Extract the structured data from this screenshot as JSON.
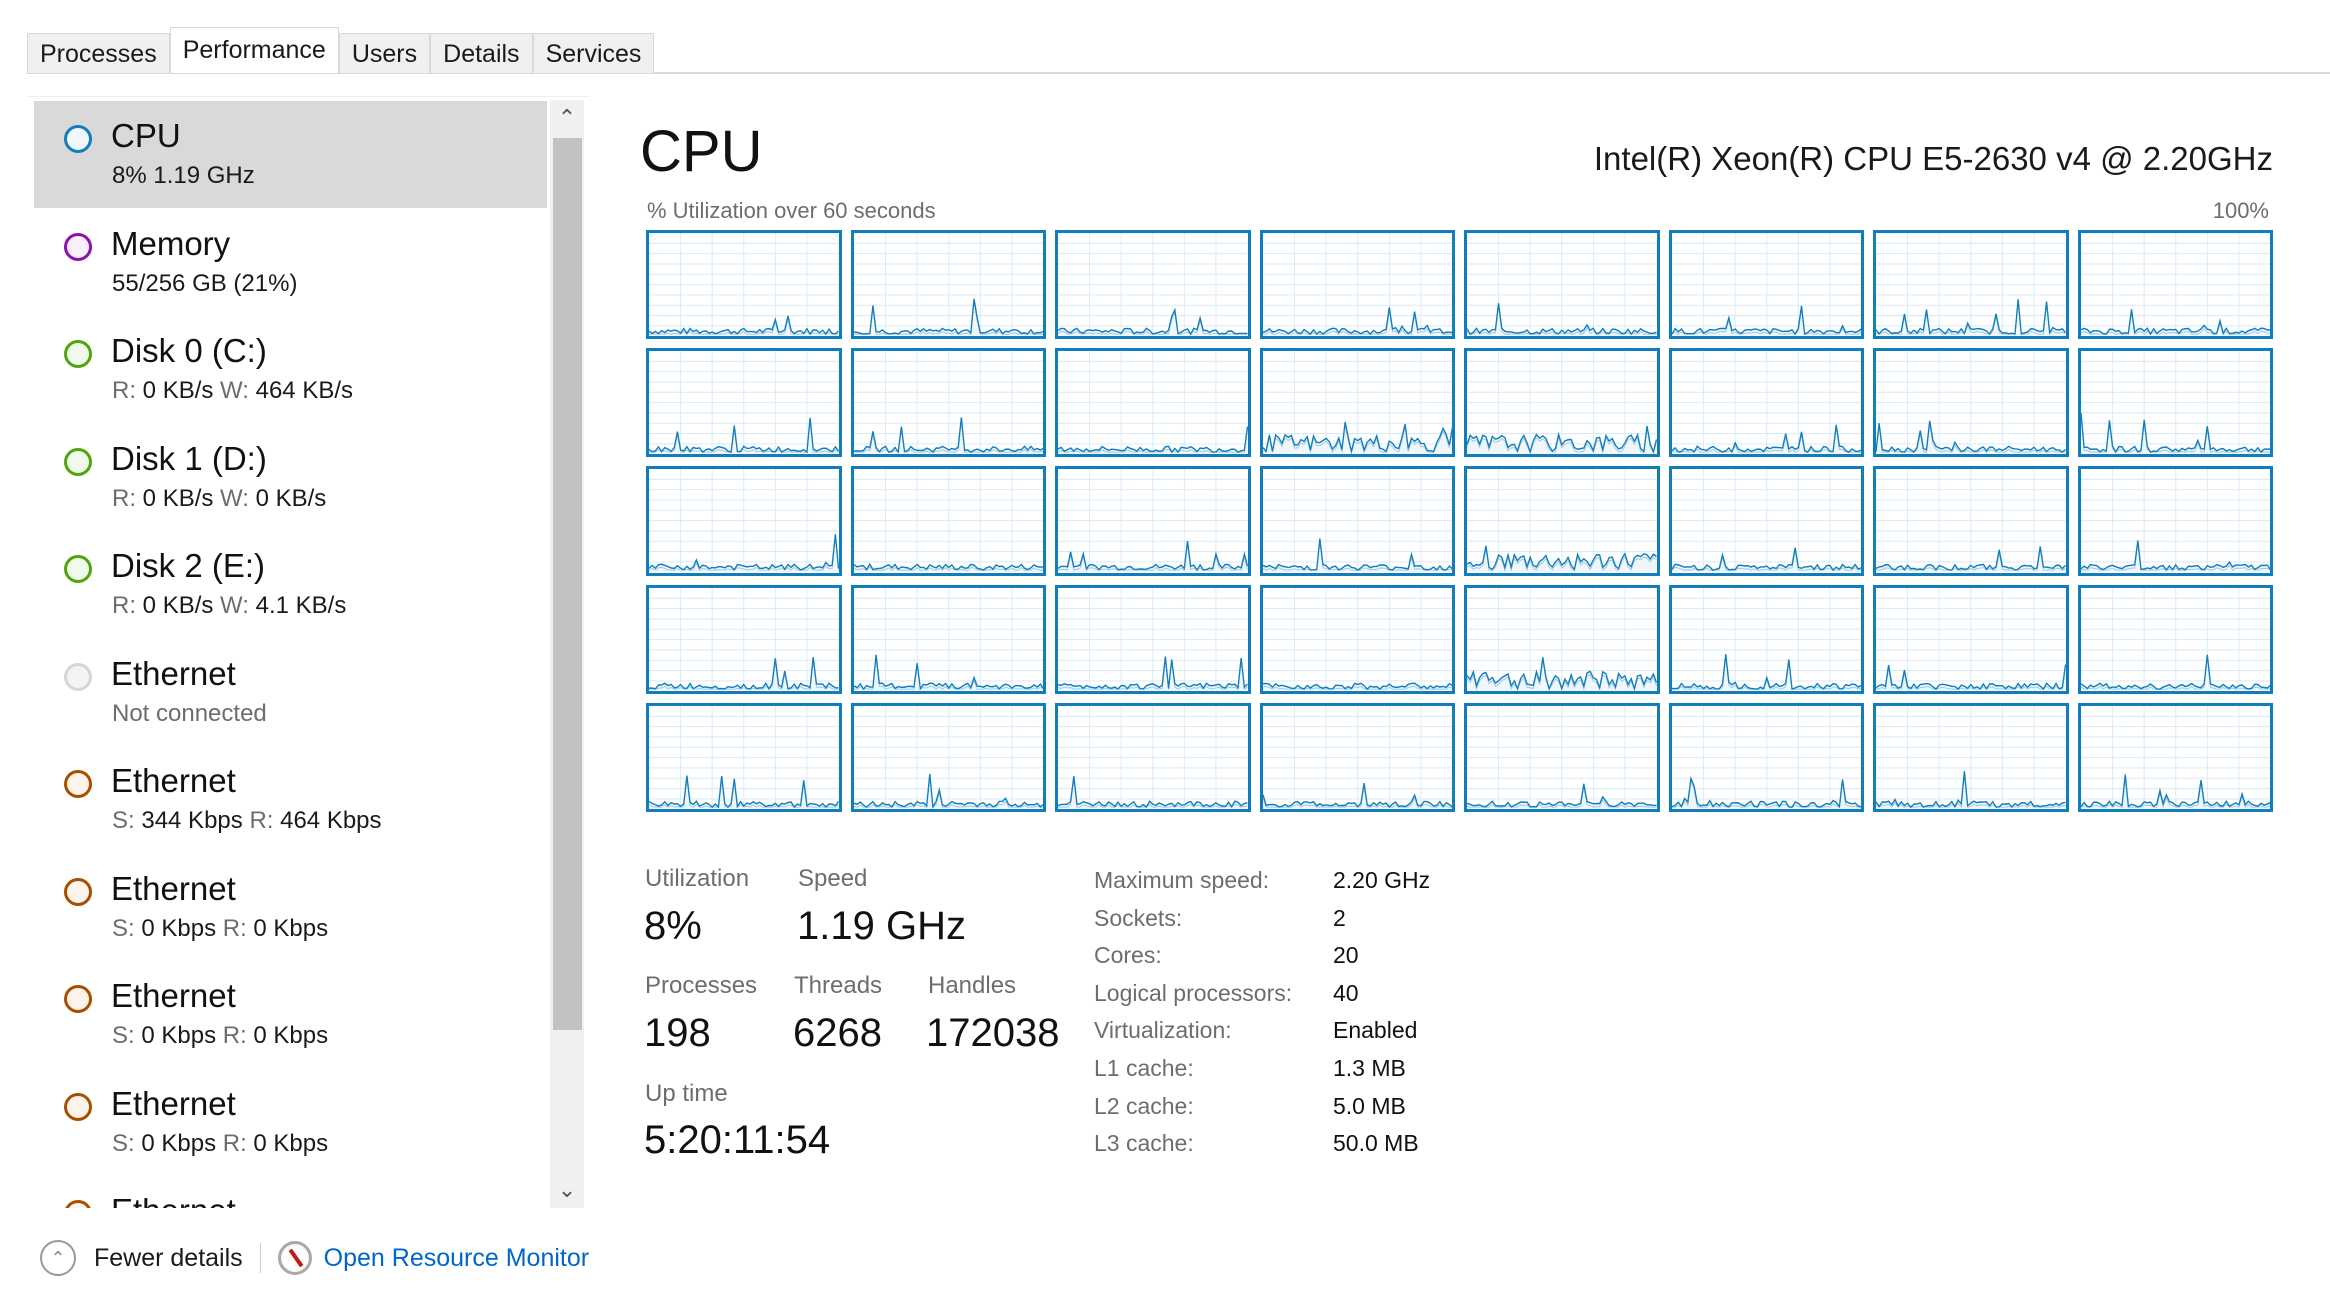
{
  "tabs": [
    {
      "label": "Processes",
      "active": false
    },
    {
      "label": "Performance",
      "active": true
    },
    {
      "label": "Users",
      "active": false
    },
    {
      "label": "Details",
      "active": false
    },
    {
      "label": "Services",
      "active": false
    }
  ],
  "sidebar": {
    "items": [
      {
        "title": "CPU",
        "sub": [
          {
            "t": "8%  1.19 GHz"
          }
        ],
        "color": "#117dbb",
        "fill": "#f1f8fd",
        "selected": true
      },
      {
        "title": "Memory",
        "sub": [
          {
            "t": "55/256 GB (21%)"
          }
        ],
        "color": "#8b12ae",
        "fill": "#f7f0fa"
      },
      {
        "title": "Disk 0 (C:)",
        "sub": [
          {
            "k": "R: "
          },
          {
            "t": "0 KB/s "
          },
          {
            "k": "W: "
          },
          {
            "t": "464 KB/s"
          }
        ],
        "color": "#4da60c",
        "fill": "#f1f9ec"
      },
      {
        "title": "Disk 1 (D:)",
        "sub": [
          {
            "k": "R: "
          },
          {
            "t": "0 KB/s "
          },
          {
            "k": "W: "
          },
          {
            "t": "0 KB/s"
          }
        ],
        "color": "#4da60c",
        "fill": "#f1f9ec"
      },
      {
        "title": "Disk 2 (E:)",
        "sub": [
          {
            "k": "R: "
          },
          {
            "t": "0 KB/s "
          },
          {
            "k": "W: "
          },
          {
            "t": "4.1 KB/s"
          }
        ],
        "color": "#4da60c",
        "fill": "#f1f9ec"
      },
      {
        "title": "Ethernet",
        "sub": [
          {
            "k": "Not connected"
          }
        ],
        "color": "#d6d6d6",
        "fill": "#f4f4f4"
      },
      {
        "title": "Ethernet",
        "sub": [
          {
            "k": "S: "
          },
          {
            "t": "344 Kbps "
          },
          {
            "k": "R: "
          },
          {
            "t": "464 Kbps"
          }
        ],
        "color": "#a74f01",
        "fill": "#fcf3eb"
      },
      {
        "title": "Ethernet",
        "sub": [
          {
            "k": "S: "
          },
          {
            "t": "0 Kbps "
          },
          {
            "k": "R: "
          },
          {
            "t": "0 Kbps"
          }
        ],
        "color": "#a74f01",
        "fill": "#fcf3eb"
      },
      {
        "title": "Ethernet",
        "sub": [
          {
            "k": "S: "
          },
          {
            "t": "0 Kbps "
          },
          {
            "k": "R: "
          },
          {
            "t": "0 Kbps"
          }
        ],
        "color": "#a74f01",
        "fill": "#fcf3eb"
      },
      {
        "title": "Ethernet",
        "sub": [
          {
            "k": "S: "
          },
          {
            "t": "0 Kbps "
          },
          {
            "k": "R: "
          },
          {
            "t": "0 Kbps"
          }
        ],
        "color": "#a74f01",
        "fill": "#fcf3eb"
      },
      {
        "title": "Ethernet",
        "sub": [],
        "color": "#a74f01",
        "fill": "#fcf3eb"
      }
    ]
  },
  "footer": {
    "fewer_details": "Fewer details",
    "open_resource_monitor": "Open Resource Monitor"
  },
  "main": {
    "title": "CPU",
    "cpu_model": "Intel(R) Xeon(R) CPU E5-2630 v4 @ 2.20GHz",
    "graph_label": "% Utilization over 60 seconds",
    "graph_max": "100%",
    "logical_processor_count": 40,
    "graph_color": "#117dbb",
    "stats": {
      "utilization_label": "Utilization",
      "utilization": "8%",
      "speed_label": "Speed",
      "speed": "1.19 GHz",
      "processes_label": "Processes",
      "processes": "198",
      "threads_label": "Threads",
      "threads": "6268",
      "handles_label": "Handles",
      "handles": "172038",
      "uptime_label": "Up time",
      "uptime": "5:20:11:54"
    },
    "specs": [
      {
        "k": "Maximum speed:",
        "v": "2.20 GHz"
      },
      {
        "k": "Sockets:",
        "v": "2"
      },
      {
        "k": "Cores:",
        "v": "20"
      },
      {
        "k": "Logical processors:",
        "v": "40"
      },
      {
        "k": "Virtualization:",
        "v": "Enabled"
      },
      {
        "k": "L1 cache:",
        "v": "1.3 MB"
      },
      {
        "k": "L2 cache:",
        "v": "5.0 MB"
      },
      {
        "k": "L3 cache:",
        "v": "50.0 MB"
      }
    ]
  }
}
